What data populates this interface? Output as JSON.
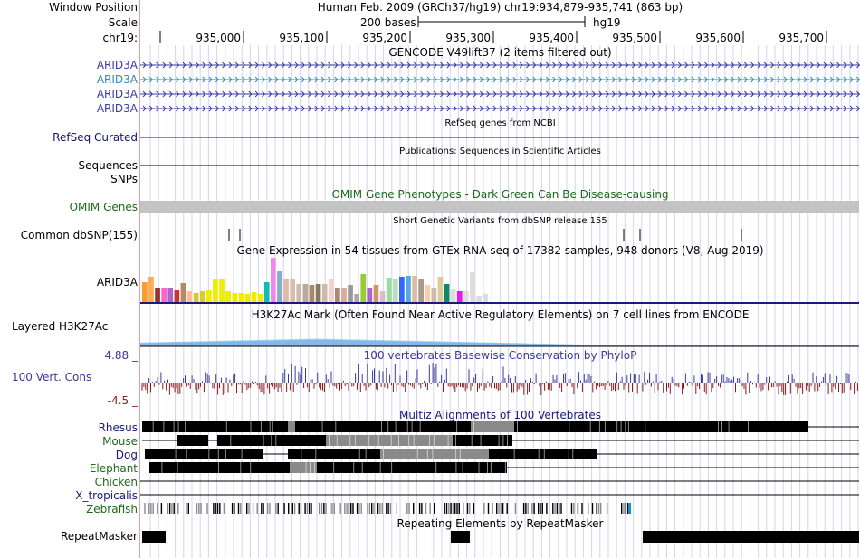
{
  "header": {
    "window_position_label": "Window Position",
    "window_position_value": "Human Feb. 2009 (GRCh37/hg19)   chr19:934,879-935,741 (863 bp)",
    "scale_label": "Scale",
    "scale_value": "200 bases",
    "assembly": "hg19",
    "chrom_label": "chr19:",
    "ruler_ticks": [
      "935,000",
      "935,100",
      "935,200",
      "935,300",
      "935,400",
      "935,500",
      "935,600",
      "935,700"
    ]
  },
  "tracks": {
    "gencode": {
      "title": "GENCODE V49lift37 (2 items filtered out)",
      "items": [
        {
          "name": "ARID3A",
          "color": "#3a3aa8"
        },
        {
          "name": "ARID3A",
          "color": "#2e8bc0"
        },
        {
          "name": "ARID3A",
          "color": "#3a3aa8"
        },
        {
          "name": "ARID3A",
          "color": "#3a3aa8"
        }
      ]
    },
    "refseq": {
      "title": "RefSeq genes from NCBI",
      "label": "RefSeq Curated",
      "color": "#141470"
    },
    "publications": {
      "title": "Publications: Sequences in Scientific Articles",
      "label": "Sequences"
    },
    "snps": {
      "label": "SNPs"
    },
    "omim": {
      "title": "OMIM Gene Phenotypes - Dark Green Can Be Disease-causing",
      "label": "OMIM Genes",
      "color": "#1a6a1a"
    },
    "dbsnp": {
      "title": "Short Genetic Variants from dbSNP release 155",
      "label": "Common dbSNP(155)"
    },
    "gtex": {
      "title": "Gene Expression in 54 tissues from GTEx RNA-seq of 17382 samples, 948 donors (V8, Aug 2019)",
      "label": "ARID3A"
    },
    "h3k27ac": {
      "title": "H3K27Ac Mark (Often Found Near Active Regulatory Elements) on 7 cell lines from ENCODE",
      "label": "Layered H3K27Ac"
    },
    "phylop": {
      "title": "100 vertebrates Basewise Conservation by PhyloP",
      "label": "100 Vert. Cons",
      "max": "4.88 _",
      "min": "-4.5 _",
      "color": "#3a3a9a"
    },
    "multiz": {
      "title": "Multiz Alignments of 100 Vertebrates",
      "species": [
        {
          "name": "Rhesus",
          "color": "#1a1a7a"
        },
        {
          "name": "Mouse",
          "color": "#1a6a1a"
        },
        {
          "name": "Dog",
          "color": "#1a1a7a"
        },
        {
          "name": "Elephant",
          "color": "#1a6a1a"
        },
        {
          "name": "Chicken",
          "color": "#1a6a1a"
        },
        {
          "name": "X_tropicalis",
          "color": "#1a1a7a"
        },
        {
          "name": "Zebrafish",
          "color": "#1a6a1a"
        }
      ]
    },
    "repeatmasker": {
      "title": "Repeating Elements by RepeatMasker",
      "label": "RepeatMasker"
    }
  },
  "gtex_chart_data": {
    "type": "bar",
    "values": [
      22,
      28,
      16,
      15,
      16,
      13,
      21,
      12,
      10,
      12,
      13,
      25,
      25,
      12,
      10,
      10,
      9,
      11,
      9,
      22,
      49,
      34,
      25,
      25,
      20,
      20,
      19,
      20,
      20,
      25,
      16,
      16,
      19,
      9,
      31,
      16,
      19,
      12,
      27,
      25,
      28,
      29,
      29,
      25,
      19,
      15,
      28,
      20,
      14,
      12,
      12,
      33,
      7,
      9
    ],
    "colors": [
      "#ff9933",
      "#ffaa55",
      "#993333",
      "#ff66cc",
      "#aa66cc",
      "#cc3333",
      "#b38a66",
      "#ffbb99",
      "#cccc33",
      "#ddcc22",
      "#eeee00",
      "#eeee00",
      "#eeee00",
      "#eeee00",
      "#eeee00",
      "#eeee00",
      "#eeee00",
      "#eeee00",
      "#eeee00",
      "#11bbbb",
      "#ee88ee",
      "#88aacc",
      "#ddbbaa",
      "#ddbbaa",
      "#ccbbaa",
      "#bbaa99",
      "#aa8866",
      "#887766",
      "#ccbbaa",
      "#ffcccc",
      "#aa8877",
      "#ddaa99",
      "#999999",
      "#aaaaaa",
      "#99cc33",
      "#aa66cc",
      "#cc9966",
      "#ddbbcc",
      "#99dd99",
      "#bbddbb",
      "#3366ff",
      "#55aadd",
      "#ddbbaa",
      "#aa9988",
      "#ffccaa",
      "#ccbbaa",
      "#ddcc99",
      "#118866",
      "#dddddd",
      "#ee11ee",
      "#dddddd",
      "#dddddd",
      "#dddddd",
      "#dddddd"
    ],
    "ylim": [
      0,
      49
    ]
  }
}
